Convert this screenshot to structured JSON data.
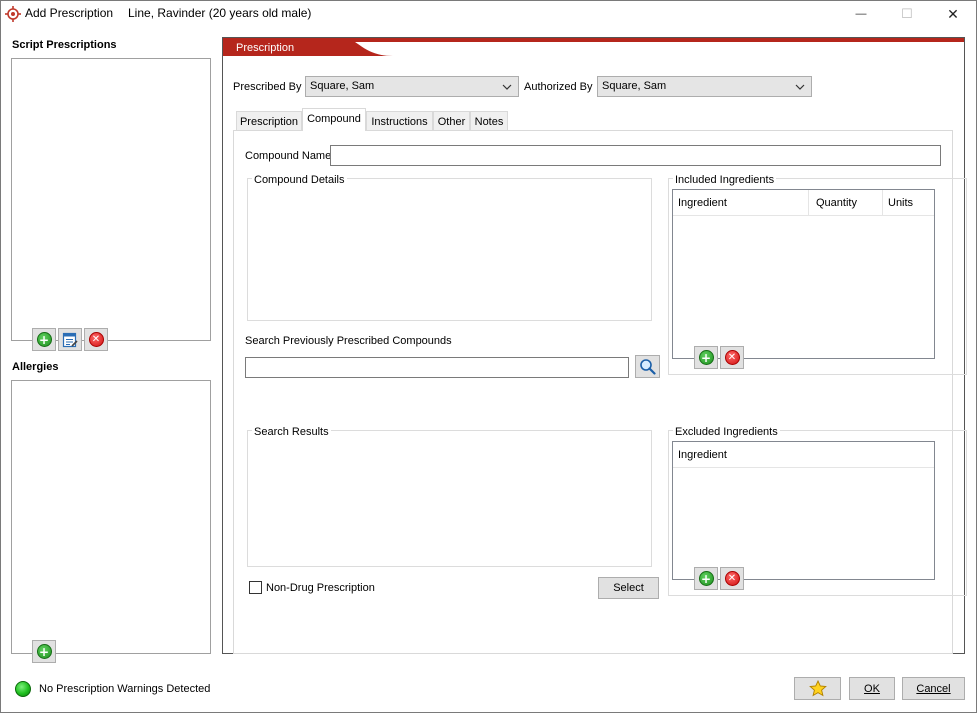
{
  "window": {
    "app_title": "Add Prescription",
    "patient": "Line, Ravinder (20 years old male)",
    "minimize_glyph": "—",
    "maximize_glyph": "☐",
    "close_glyph": "✕"
  },
  "left": {
    "script_label": "Script Prescriptions",
    "allergies_label": "Allergies"
  },
  "panel": {
    "header": "Prescription",
    "prescribed_by_label": "Prescribed By",
    "prescribed_by_value": "Square, Sam",
    "authorized_by_label": "Authorized By",
    "authorized_by_value": "Square, Sam"
  },
  "tabs": [
    {
      "label": "Prescription",
      "active": false
    },
    {
      "label": "Compound",
      "active": true
    },
    {
      "label": "Instructions",
      "active": false
    },
    {
      "label": "Other",
      "active": false
    },
    {
      "label": "Notes",
      "active": false
    }
  ],
  "compound": {
    "name_label": "Compound Name",
    "name_value": "",
    "details_label": "Compound Details",
    "search_label": "Search Previously Prescribed Compounds",
    "search_value": "",
    "results_label": "Search Results",
    "non_drug_label": "Non-Drug Prescription",
    "non_drug_checked": false,
    "select_label": "Select"
  },
  "included": {
    "title": "Included Ingredients",
    "columns": [
      "Ingredient",
      "Quantity",
      "Units"
    ]
  },
  "excluded": {
    "title": "Excluded Ingredients",
    "columns": [
      "Ingredient"
    ]
  },
  "footer": {
    "status_text": "No Prescription Warnings Detected",
    "status_color": "#1fbf1f",
    "ok_label": "OK",
    "cancel_label": "Cancel",
    "favorite_icon": "star-icon"
  },
  "colors": {
    "accent": "#b5261c"
  }
}
